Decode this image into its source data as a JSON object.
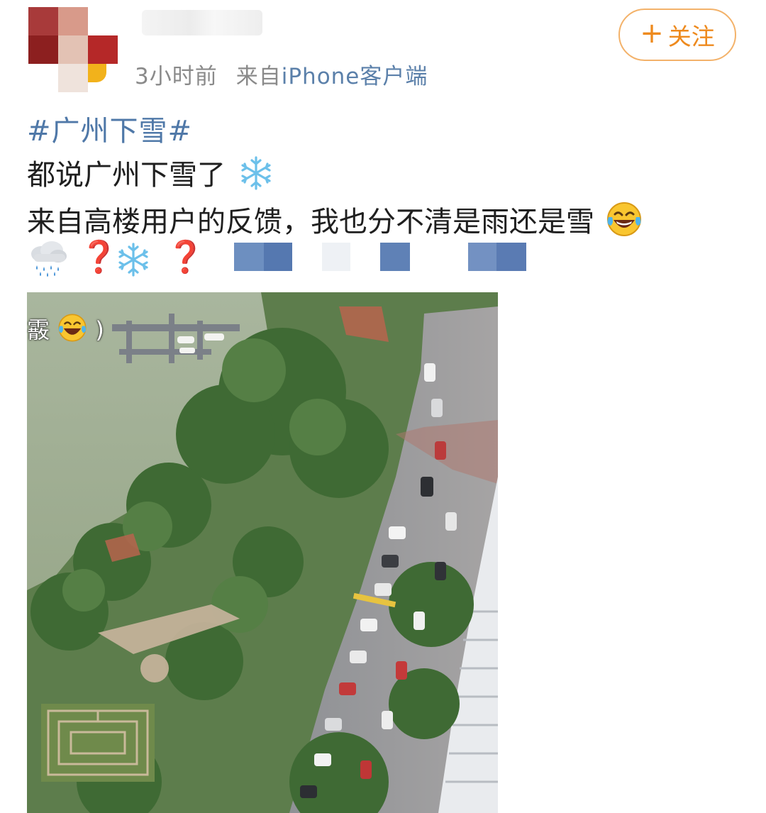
{
  "post": {
    "time": "3小时前",
    "from_label": "来自",
    "source": "iPhone客户端",
    "follow_label": "关注",
    "hashtag": "#广州下雪#",
    "line1": "都说广州下雪了",
    "line2": "来自高楼用户的反馈，我也分不清是雨还是雪",
    "question_mark": "❓",
    "image_overlay_text": "霰",
    "image_overlay_suffix": ")"
  },
  "icons": {
    "snowflake": "snowflake-icon",
    "laugh": "laughing-tears-emoji",
    "rain": "rain-cloud-emoji",
    "plus": "plus-icon"
  },
  "colors": {
    "link": "#4f78a8",
    "follow": "#ee8a1e",
    "meta": "#8a8a8a",
    "question": "#d8232a"
  }
}
